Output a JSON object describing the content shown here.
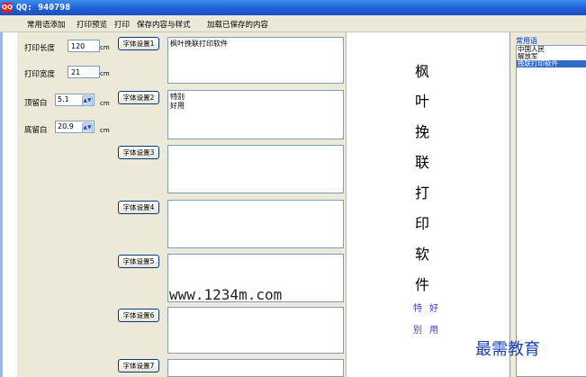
{
  "window": {
    "title": "QQ: 940798",
    "icon": "qq-icon"
  },
  "menu": [
    "常用语添加",
    "打印预览",
    "打印",
    "保存内容与样式",
    "加载已保存的内容"
  ],
  "form": {
    "length_label": "打印长度",
    "length_value": "120",
    "length_unit": "cm",
    "width_label": "打印宽度",
    "width_value": "21",
    "width_unit": "cm",
    "top_label": "顶留白",
    "top_value": "5.1",
    "top_unit": "cm",
    "bottom_label": "底留白",
    "bottom_value": "20.9",
    "bottom_unit": "cm"
  },
  "font_buttons": [
    "字体设置1",
    "字体设置2",
    "字体设置3",
    "字体设置4",
    "字体设置5",
    "字体设置6",
    "字体设置7"
  ],
  "text_areas": [
    "枫叶挽联打印软件",
    "特别\n好用",
    "",
    "",
    "",
    "",
    ""
  ],
  "preview": {
    "main_chars": [
      "枫",
      "叶",
      "挽",
      "联",
      "打",
      "印",
      "软",
      "件"
    ],
    "small_chars": [
      "特",
      "好",
      "别",
      "用"
    ]
  },
  "phrases": {
    "header": "常用语",
    "items": [
      "中国人民",
      "解放军",
      "挽联打印软件"
    ],
    "selected_index": 2
  },
  "watermark": "www.1234m.com",
  "brand": "最需教育",
  "colors": {
    "titlebar": "#1f5fd6",
    "selected": "#316ac5",
    "preview_small": "#3a3ae0",
    "brand": "#1a3fb8"
  }
}
